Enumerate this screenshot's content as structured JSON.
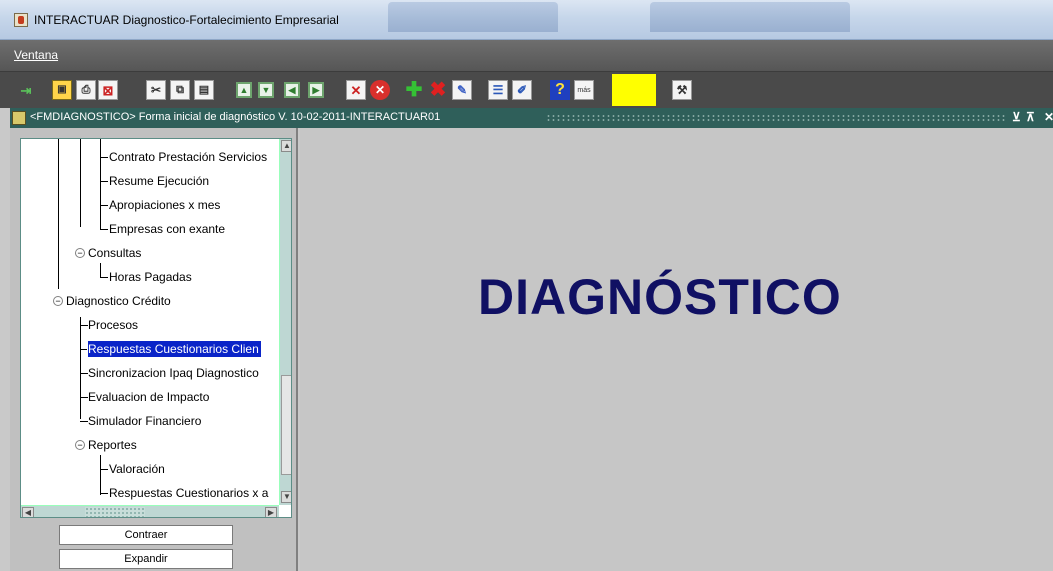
{
  "window": {
    "title": "INTERACTUAR Diagnostico-Fortalecimiento Empresarial"
  },
  "menubar": {
    "items": [
      "Ventana"
    ]
  },
  "toolbar": {
    "highlight_color": "#ffff00",
    "icons": [
      "exit-icon",
      "save-icon",
      "print-icon",
      "clear-icon",
      "cut-icon",
      "copy-icon",
      "paste-icon",
      "first-record-icon",
      "previous-record-icon",
      "next-record-icon",
      "last-record-icon",
      "query-icon",
      "cancel-icon",
      "insert-record-icon",
      "delete-record-icon",
      "edit-icon",
      "list-icon",
      "edit-field-icon",
      "help-icon",
      "more-icon",
      "tools-icon"
    ],
    "more_label": "más"
  },
  "form": {
    "title": "<FMDIAGNOSTICO> Forma inicial de diagnóstico V. 10-02-2011-INTERACTUAR01",
    "heading": "DIAGNÓSTICO",
    "heading_color": "#101063"
  },
  "tree": {
    "nodes": [
      {
        "label": "Contrato Prestación Servicios",
        "level": 3
      },
      {
        "label": "Resume Ejecución",
        "level": 3
      },
      {
        "label": "Apropiaciones x mes",
        "level": 3
      },
      {
        "label": "Empresas con exante",
        "level": 3
      },
      {
        "label": "Consultas",
        "level": 2,
        "expanded": true
      },
      {
        "label": "Horas Pagadas",
        "level": 3
      },
      {
        "label": "Diagnostico Crédito",
        "level": 1,
        "expanded": true
      },
      {
        "label": "Procesos",
        "level": 2
      },
      {
        "label": "Respuestas Cuestionarios Clien",
        "level": 2,
        "selected": true
      },
      {
        "label": "Sincronizacion Ipaq Diagnostico",
        "level": 2
      },
      {
        "label": "Evaluacion de Impacto",
        "level": 2
      },
      {
        "label": "Simulador Financiero",
        "level": 2
      },
      {
        "label": "Reportes",
        "level": 2,
        "expanded": true
      },
      {
        "label": "Valoración",
        "level": 3
      },
      {
        "label": "Respuestas Cuestionarios x a",
        "level": 3
      }
    ],
    "selected_color": "#0a24c8"
  },
  "buttons": {
    "collapse": "Contraer",
    "expand": "Expandir"
  }
}
